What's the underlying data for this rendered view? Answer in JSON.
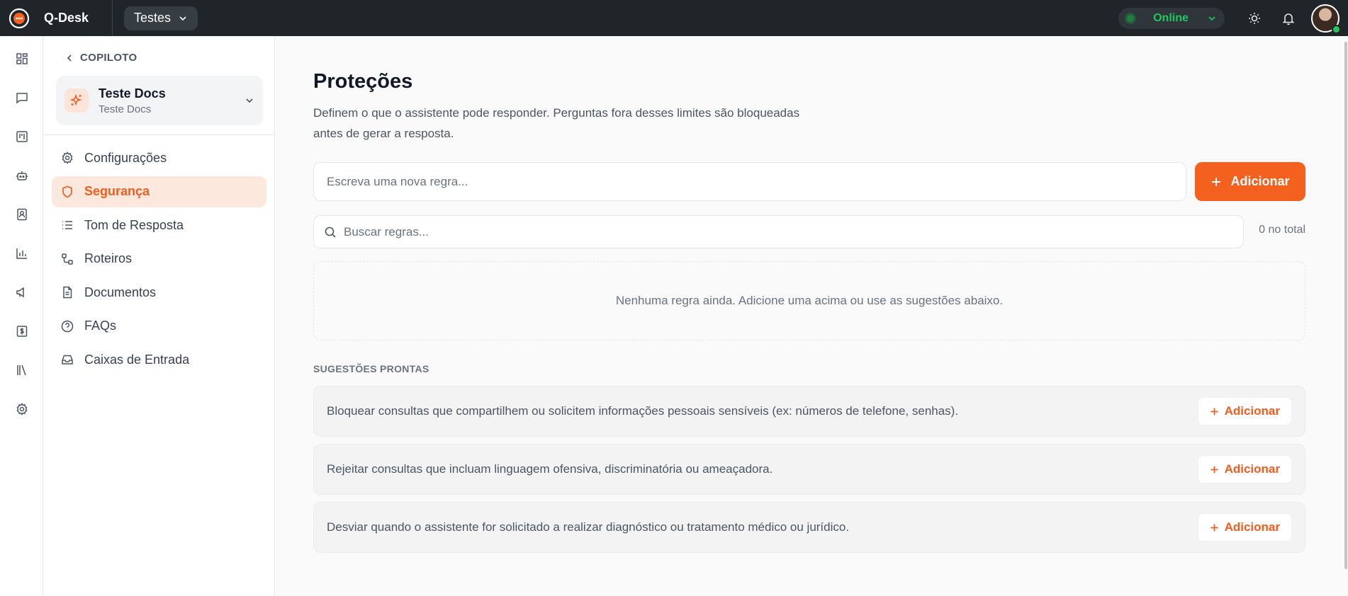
{
  "app": {
    "name": "Q-Desk",
    "workspace": "Testes"
  },
  "topbar": {
    "status": "Online",
    "icons": [
      "sun-icon",
      "bell-icon"
    ]
  },
  "rail": {
    "icons": [
      "dashboard-icon",
      "chat-icon",
      "kanban-icon",
      "bot-icon",
      "contacts-icon",
      "reports-icon",
      "campaigns-icon",
      "billing-icon",
      "library-icon",
      "settings-icon"
    ]
  },
  "sidebar": {
    "back_label": "COPILOTO",
    "bot": {
      "name": "Teste Docs",
      "subtitle": "Teste Docs"
    },
    "items": [
      {
        "label": "Configurações",
        "icon": "gear-icon"
      },
      {
        "label": "Segurança",
        "icon": "shield-icon",
        "active": true
      },
      {
        "label": "Tom de Resposta",
        "icon": "list-icon"
      },
      {
        "label": "Roteiros",
        "icon": "workflow-icon"
      },
      {
        "label": "Documentos",
        "icon": "document-icon"
      },
      {
        "label": "FAQs",
        "icon": "help-icon"
      },
      {
        "label": "Caixas de Entrada",
        "icon": "inbox-icon"
      }
    ]
  },
  "main": {
    "title": "Proteções",
    "description": "Definem o que o assistente pode responder. Perguntas fora desses limites são bloqueadas antes de gerar a resposta.",
    "new_rule_placeholder": "Escreva uma nova regra...",
    "add_label": "Adicionar",
    "search_placeholder": "Buscar regras...",
    "total": "0 no total",
    "empty_message": "Nenhuma regra ainda. Adicione uma acima ou use as sugestões abaixo.",
    "suggestions_title": "SUGESTÕES PRONTAS",
    "suggestions": [
      {
        "text": "Bloquear consultas que compartilhem ou solicitem informações pessoais sensíveis (ex: números de telefone, senhas).",
        "button": "Adicionar"
      },
      {
        "text": "Rejeitar consultas que incluam linguagem ofensiva, discriminatória ou ameaçadora.",
        "button": "Adicionar"
      },
      {
        "text": "Desviar quando o assistente for solicitado a realizar diagnóstico ou tratamento médico ou jurídico.",
        "button": "Adicionar"
      }
    ]
  },
  "colors": {
    "accent": "#f4601e",
    "topbar": "#1f2529",
    "online": "#22c55e"
  }
}
